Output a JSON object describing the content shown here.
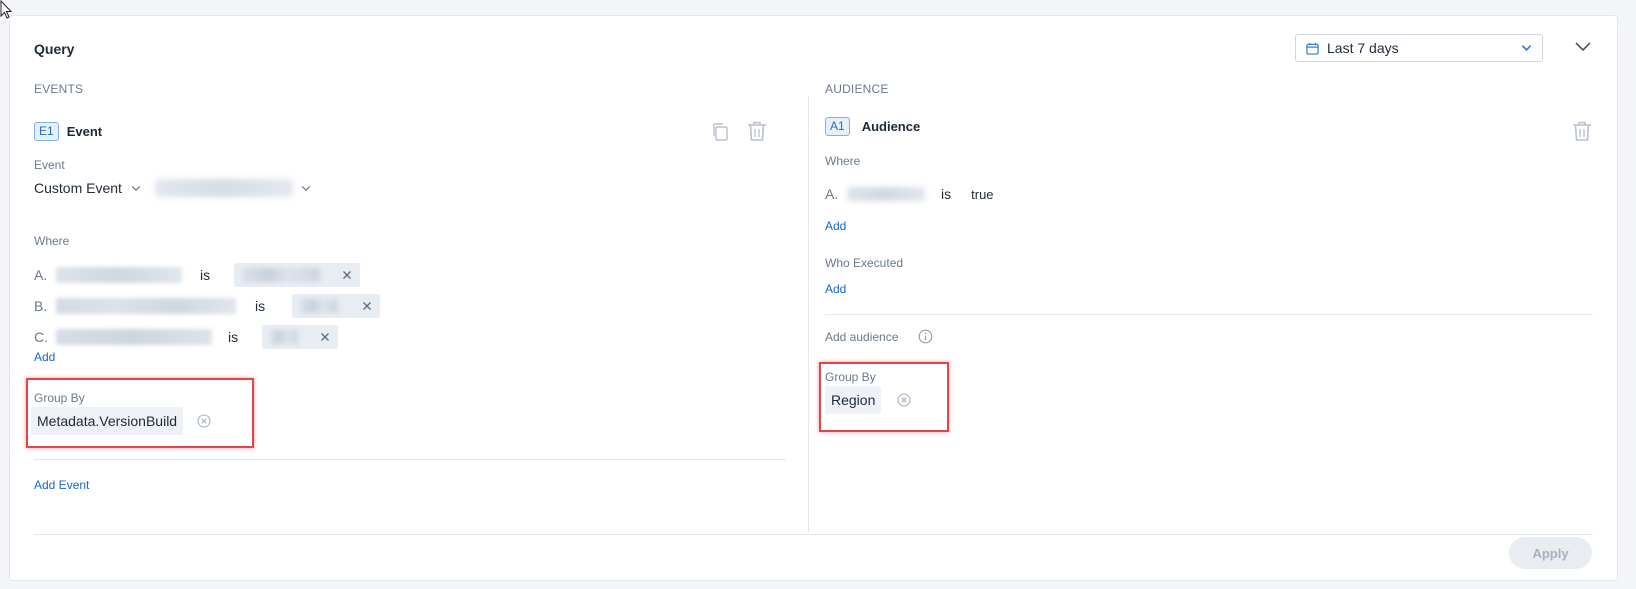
{
  "query": {
    "title": "Query",
    "date_range": "Last 7 days"
  },
  "events": {
    "section_label": "EVENTS",
    "badge": "E1",
    "name": "Event",
    "event_field_label": "Event",
    "event_type": "Custom Event",
    "where_label": "Where",
    "conditions": [
      {
        "letter": "A.",
        "op": "is"
      },
      {
        "letter": "B.",
        "op": "is"
      },
      {
        "letter": "C.",
        "op": "is"
      }
    ],
    "add_label": "Add",
    "group_by_label": "Group By",
    "group_by_value": "Metadata.VersionBuild",
    "add_event_label": "Add Event"
  },
  "audience": {
    "section_label": "AUDIENCE",
    "badge": "A1",
    "name": "Audience",
    "where_label": "Where",
    "condition": {
      "letter": "A.",
      "op": "is",
      "value": "true"
    },
    "add_label": "Add",
    "who_executed_label": "Who Executed",
    "who_add_label": "Add",
    "add_audience_label": "Add audience",
    "group_by_label": "Group By",
    "group_by_value": "Region"
  },
  "actions": {
    "apply_label": "Apply"
  },
  "colors": {
    "accent": "#1a66cc",
    "highlight": "#e0454b"
  },
  "icons": [
    "mouse-cursor-icon",
    "calendar-icon",
    "chevron-down-icon",
    "copy-icon",
    "trash-icon",
    "info-icon",
    "close-icon",
    "circle-close-icon"
  ]
}
